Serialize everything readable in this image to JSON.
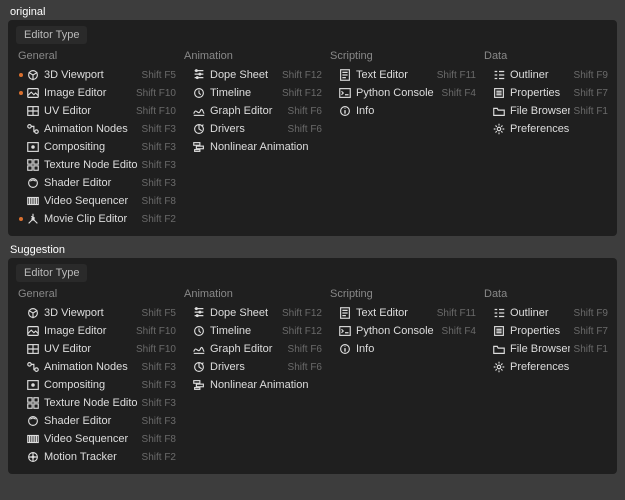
{
  "panels": [
    {
      "title": "original",
      "header": "Editor Type"
    },
    {
      "title": "Suggestion",
      "header": "Editor Type"
    }
  ],
  "columns": {
    "general": "General",
    "animation": "Animation",
    "scripting": "Scripting",
    "data": "Data"
  },
  "original": {
    "general": [
      {
        "icon": "viewport",
        "label": "3D Viewport",
        "shortcut": "Shift F5",
        "dot": true
      },
      {
        "icon": "image",
        "label": "Image Editor",
        "shortcut": "Shift F10",
        "dot": true
      },
      {
        "icon": "uv",
        "label": "UV Editor",
        "shortcut": "Shift F10",
        "dot": false
      },
      {
        "icon": "nodes",
        "label": "Animation Nodes",
        "shortcut": "Shift F3",
        "dot": false
      },
      {
        "icon": "compositor",
        "label": "Compositing",
        "shortcut": "Shift F3",
        "dot": false
      },
      {
        "icon": "texnodes",
        "label": "Texture Node Editor",
        "shortcut": "Shift F3",
        "dot": false
      },
      {
        "icon": "shader",
        "label": "Shader Editor",
        "shortcut": "Shift F3",
        "dot": false
      },
      {
        "icon": "sequencer",
        "label": "Video Sequencer",
        "shortcut": "Shift F8",
        "dot": false
      },
      {
        "icon": "movieclip",
        "label": "Movie Clip Editor",
        "shortcut": "Shift F2",
        "dot": true
      }
    ],
    "animation": [
      {
        "icon": "dope",
        "label": "Dope Sheet",
        "shortcut": "Shift F12"
      },
      {
        "icon": "timeline",
        "label": "Timeline",
        "shortcut": "Shift F12"
      },
      {
        "icon": "graph",
        "label": "Graph Editor",
        "shortcut": "Shift F6"
      },
      {
        "icon": "drivers",
        "label": "Drivers",
        "shortcut": "Shift F6"
      },
      {
        "icon": "nla",
        "label": "Nonlinear Animation",
        "shortcut": ""
      }
    ],
    "scripting": [
      {
        "icon": "text",
        "label": "Text Editor",
        "shortcut": "Shift F11"
      },
      {
        "icon": "console",
        "label": "Python Console",
        "shortcut": "Shift F4"
      },
      {
        "icon": "info",
        "label": "Info",
        "shortcut": ""
      }
    ],
    "data": [
      {
        "icon": "outliner",
        "label": "Outliner",
        "shortcut": "Shift F9"
      },
      {
        "icon": "props",
        "label": "Properties",
        "shortcut": "Shift F7"
      },
      {
        "icon": "filebrw",
        "label": "File Browser",
        "shortcut": "Shift F1"
      },
      {
        "icon": "prefs",
        "label": "Preferences",
        "shortcut": ""
      }
    ]
  },
  "suggestion": {
    "general": [
      {
        "icon": "viewport",
        "label": "3D Viewport",
        "shortcut": "Shift F5",
        "dot": false
      },
      {
        "icon": "image",
        "label": "Image Editor",
        "shortcut": "Shift F10",
        "dot": false
      },
      {
        "icon": "uv",
        "label": "UV Editor",
        "shortcut": "Shift F10",
        "dot": false
      },
      {
        "icon": "nodes",
        "label": "Animation Nodes",
        "shortcut": "Shift F3",
        "dot": false
      },
      {
        "icon": "compositor",
        "label": "Compositing",
        "shortcut": "Shift F3",
        "dot": false
      },
      {
        "icon": "texnodes",
        "label": "Texture Node Editor",
        "shortcut": "Shift F3",
        "dot": false
      },
      {
        "icon": "shader",
        "label": "Shader Editor",
        "shortcut": "Shift F3",
        "dot": false
      },
      {
        "icon": "sequencer",
        "label": "Video Sequencer",
        "shortcut": "Shift F8",
        "dot": false
      },
      {
        "icon": "tracker",
        "label": "Motion Tracker",
        "shortcut": "Shift F2",
        "dot": false
      }
    ],
    "animation": [
      {
        "icon": "dope",
        "label": "Dope Sheet",
        "shortcut": "Shift F12"
      },
      {
        "icon": "timeline",
        "label": "Timeline",
        "shortcut": "Shift F12"
      },
      {
        "icon": "graph",
        "label": "Graph Editor",
        "shortcut": "Shift F6"
      },
      {
        "icon": "drivers",
        "label": "Drivers",
        "shortcut": "Shift F6"
      },
      {
        "icon": "nla",
        "label": "Nonlinear Animation",
        "shortcut": ""
      }
    ],
    "scripting": [
      {
        "icon": "text",
        "label": "Text Editor",
        "shortcut": "Shift F11"
      },
      {
        "icon": "console",
        "label": "Python Console",
        "shortcut": "Shift F4"
      },
      {
        "icon": "info",
        "label": "Info",
        "shortcut": ""
      }
    ],
    "data": [
      {
        "icon": "outliner",
        "label": "Outliner",
        "shortcut": "Shift F9"
      },
      {
        "icon": "props",
        "label": "Properties",
        "shortcut": "Shift F7"
      },
      {
        "icon": "filebrw",
        "label": "File Browser",
        "shortcut": "Shift F1"
      },
      {
        "icon": "prefs",
        "label": "Preferences",
        "shortcut": ""
      }
    ]
  },
  "icon_names": {
    "viewport": "viewport-icon",
    "image": "image-icon",
    "uv": "uv-icon",
    "nodes": "nodes-icon",
    "compositor": "compositor-icon",
    "texnodes": "texture-nodes-icon",
    "shader": "shader-icon",
    "sequencer": "sequencer-icon",
    "movieclip": "movieclip-icon",
    "tracker": "tracker-icon",
    "dope": "dopesheet-icon",
    "timeline": "timeline-icon",
    "graph": "graph-icon",
    "drivers": "drivers-icon",
    "nla": "nla-icon",
    "text": "text-editor-icon",
    "console": "console-icon",
    "info": "info-icon",
    "outliner": "outliner-icon",
    "props": "properties-icon",
    "filebrw": "file-browser-icon",
    "prefs": "preferences-icon"
  }
}
